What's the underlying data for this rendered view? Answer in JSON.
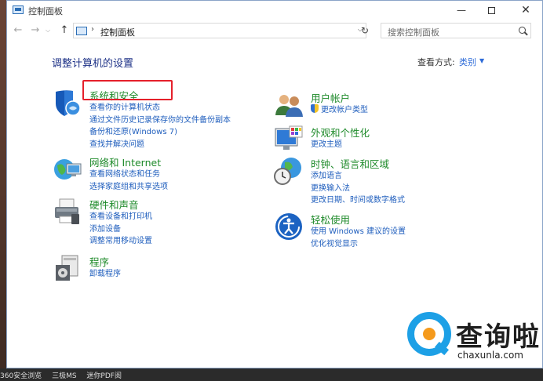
{
  "window": {
    "title": "控制面板",
    "minimize": "—",
    "close": "✕"
  },
  "address": {
    "separator": "›",
    "path": "控制面板",
    "dropdown": "⌵",
    "refresh": "↻",
    "search_placeholder": "搜索控制面板"
  },
  "nav": {
    "back": "←",
    "forward": "→",
    "recent": "⌵",
    "up": "↑"
  },
  "main": {
    "heading": "调整计算机的设置",
    "view_by_label": "查看方式:",
    "view_by_value": "类别",
    "view_by_arrow": "▼"
  },
  "categories_left": [
    {
      "title": "系统和安全",
      "icon": "shield-icon",
      "links": [
        "查看你的计算机状态",
        "通过文件历史记录保存你的文件备份副本",
        "备份和还原(Windows 7)",
        "查找并解决问题"
      ]
    },
    {
      "title": "网络和 Internet",
      "icon": "network-globe-icon",
      "links": [
        "查看网络状态和任务",
        "选择家庭组和共享选项"
      ]
    },
    {
      "title": "硬件和声音",
      "icon": "printer-icon",
      "links": [
        "查看设备和打印机",
        "添加设备",
        "调整常用移动设置"
      ]
    },
    {
      "title": "程序",
      "icon": "programs-icon",
      "links": [
        "卸载程序"
      ]
    }
  ],
  "categories_right": [
    {
      "title": "用户帐户",
      "icon": "users-icon",
      "links": [
        "更改帐户类型"
      ]
    },
    {
      "title": "外观和个性化",
      "icon": "monitor-palette-icon",
      "links": [
        "更改主题"
      ]
    },
    {
      "title": "时钟、语言和区域",
      "icon": "clock-globe-icon",
      "links": [
        "添加语言",
        "更换输入法",
        "更改日期、时间或数字格式"
      ]
    },
    {
      "title": "轻松使用",
      "icon": "accessibility-icon",
      "links": [
        "使用 Windows 建议的设置",
        "优化视觉显示"
      ]
    }
  ],
  "watermark": {
    "text": "查询啦",
    "url": "chaxunla.com"
  },
  "taskbar": {
    "items": [
      "360安全浏览",
      "三极MS",
      "迷你PDF阅"
    ]
  }
}
